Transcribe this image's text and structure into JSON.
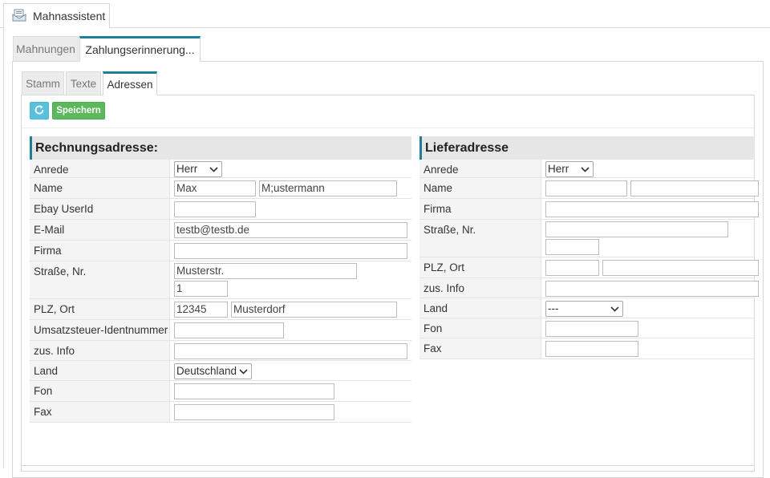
{
  "window": {
    "title": "Mahnassistent",
    "icon": "envelope-document-icon"
  },
  "tabs_level2": [
    {
      "label": "Mahnungen",
      "active": false
    },
    {
      "label": "Zahlungserinnerung...",
      "active": true
    }
  ],
  "tabs_level3": [
    {
      "label": "Stamm",
      "active": false
    },
    {
      "label": "Texte",
      "active": false
    },
    {
      "label": "Adressen",
      "active": true
    }
  ],
  "toolbar": {
    "refresh_icon": "refresh-icon",
    "save_label": "Speichern"
  },
  "colors": {
    "accent": "#1d7f98",
    "save": "#5cb85c",
    "refresh": "#5bc0de"
  },
  "billing": {
    "title": "Rechnungsadresse:",
    "labels": {
      "salutation": "Anrede",
      "name": "Name",
      "ebay": "Ebay UserId",
      "email": "E-Mail",
      "company": "Firma",
      "street": "Straße, Nr.",
      "zip_city": "PLZ, Ort",
      "vat": "Umsatzsteuer-Identnummer",
      "extra": "zus. Info",
      "country": "Land",
      "phone": "Fon",
      "fax": "Fax"
    },
    "values": {
      "salutation": "Herr",
      "first_name": "Max",
      "last_name": "M;ustermann",
      "ebay": "",
      "email": "testb@testb.de",
      "company": "",
      "street": "Musterstr.",
      "house_no": "1",
      "zip": "12345",
      "city": "Musterdorf",
      "vat": "",
      "extra": "",
      "country": "Deutschland",
      "phone": "",
      "fax": ""
    }
  },
  "delivery": {
    "title": "Lieferadresse",
    "labels": {
      "salutation": "Anrede",
      "name": "Name",
      "company": "Firma",
      "street": "Straße, Nr.",
      "zip_city": "PLZ, Ort",
      "extra": "zus. Info",
      "country": "Land",
      "phone": "Fon",
      "fax": "Fax"
    },
    "values": {
      "salutation": "Herr",
      "first_name": "",
      "last_name": "",
      "company": "",
      "street": "",
      "house_no": "",
      "zip": "",
      "city": "",
      "extra": "",
      "country": "---",
      "phone": "",
      "fax": ""
    }
  }
}
